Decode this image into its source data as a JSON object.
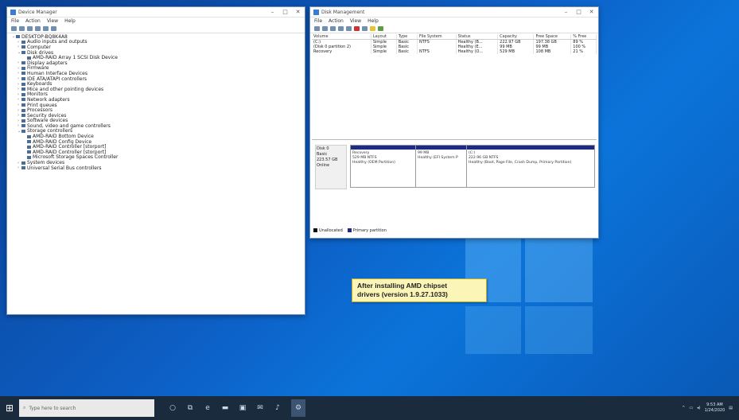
{
  "device_manager": {
    "title": "Device Manager",
    "menu": [
      "File",
      "Action",
      "View",
      "Help"
    ],
    "tree": [
      {
        "label": "DESKTOP-BQ8K4A8",
        "depth": 0,
        "expanded": true
      },
      {
        "label": "Audio inputs and outputs",
        "depth": 1
      },
      {
        "label": "Computer",
        "depth": 1
      },
      {
        "label": "Disk drives",
        "depth": 1,
        "expanded": true
      },
      {
        "label": "AMD-RAID Array 1 SCSI Disk Device",
        "depth": 2
      },
      {
        "label": "Display adapters",
        "depth": 1
      },
      {
        "label": "Firmware",
        "depth": 1
      },
      {
        "label": "Human Interface Devices",
        "depth": 1
      },
      {
        "label": "IDE ATA/ATAPI controllers",
        "depth": 1
      },
      {
        "label": "Keyboards",
        "depth": 1
      },
      {
        "label": "Mice and other pointing devices",
        "depth": 1
      },
      {
        "label": "Monitors",
        "depth": 1
      },
      {
        "label": "Network adapters",
        "depth": 1
      },
      {
        "label": "Print queues",
        "depth": 1
      },
      {
        "label": "Processors",
        "depth": 1
      },
      {
        "label": "Security devices",
        "depth": 1
      },
      {
        "label": "Software devices",
        "depth": 1
      },
      {
        "label": "Sound, video and game controllers",
        "depth": 1
      },
      {
        "label": "Storage controllers",
        "depth": 1,
        "expanded": true
      },
      {
        "label": "AMD-RAID Bottom Device",
        "depth": 2
      },
      {
        "label": "AMD-RAID Config Device",
        "depth": 2
      },
      {
        "label": "AMD-RAID Controller [storport]",
        "depth": 2
      },
      {
        "label": "AMD-RAID Controller [storport]",
        "depth": 2
      },
      {
        "label": "Microsoft Storage Spaces Controller",
        "depth": 2
      },
      {
        "label": "System devices",
        "depth": 1
      },
      {
        "label": "Universal Serial Bus controllers",
        "depth": 1
      }
    ]
  },
  "disk_management": {
    "title": "Disk Management",
    "menu": [
      "File",
      "Action",
      "View",
      "Help"
    ],
    "columns": [
      "Volume",
      "Layout",
      "Type",
      "File System",
      "Status",
      "Capacity",
      "Free Space",
      "% Free"
    ],
    "rows": [
      [
        "(C:)",
        "Simple",
        "Basic",
        "NTFS",
        "Healthy (B...",
        "222.97 GB",
        "197.38 GB",
        "89 %"
      ],
      [
        "(Disk 0 partition 2)",
        "Simple",
        "Basic",
        "",
        "Healthy (E...",
        "99 MB",
        "99 MB",
        "100 %"
      ],
      [
        "Recovery",
        "Simple",
        "Basic",
        "NTFS",
        "Healthy (O...",
        "529 MB",
        "108 MB",
        "21 %"
      ]
    ],
    "disk": {
      "name": "Disk 0",
      "kind": "Basic",
      "size": "223.57 GB",
      "state": "Online"
    },
    "partitions": [
      {
        "name": "Recovery",
        "size": "529 MB NTFS",
        "status": "Healthy (OEM Partition)"
      },
      {
        "name": "",
        "size": "99 MB",
        "status": "Healthy (EFI System P"
      },
      {
        "name": "(C:)",
        "size": "222.96 GB NTFS",
        "status": "Healthy (Boot, Page File, Crash Dump, Primary Partition)"
      }
    ],
    "legend": [
      "Unallocated",
      "Primary partition"
    ]
  },
  "callout": {
    "line1": "After installing AMD chipset",
    "line2": "drivers (version 1.9.27.1033)"
  },
  "taskbar": {
    "search_placeholder": "Type here to search",
    "time": "9:53 AM",
    "date": "1/24/2020"
  }
}
